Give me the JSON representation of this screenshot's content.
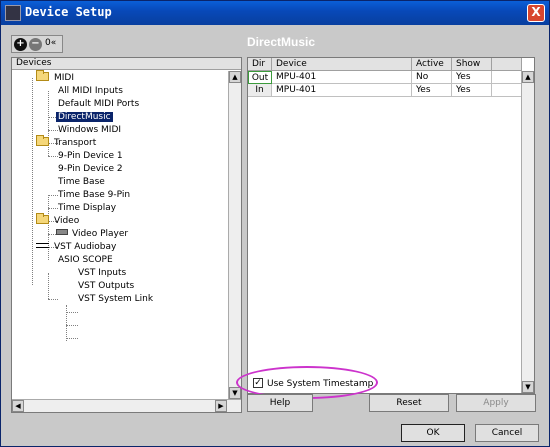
{
  "window": {
    "title": "Device Setup",
    "close_label": "X"
  },
  "toolbar": {
    "add_label": "+",
    "remove_label": "−",
    "collapse_label": "0«"
  },
  "section_title": "DirectMusic",
  "tree": {
    "header": "Devices",
    "nodes": [
      {
        "label": "MIDI",
        "icon": "folder-icon"
      },
      {
        "label": "All MIDI Inputs"
      },
      {
        "label": "Default MIDI Ports"
      },
      {
        "label": "DirectMusic",
        "selected": true
      },
      {
        "label": "Windows MIDI"
      },
      {
        "label": "Transport",
        "icon": "folder-icon"
      },
      {
        "label": "9-Pin Device 1"
      },
      {
        "label": "9-Pin Device 2"
      },
      {
        "label": "Time Base"
      },
      {
        "label": "Time Base 9-Pin"
      },
      {
        "label": "Time Display"
      },
      {
        "label": "Video",
        "icon": "folder-icon"
      },
      {
        "label": "Video Player",
        "icon": "video-icon"
      },
      {
        "label": "VST Audiobay",
        "icon": "audio-icon"
      },
      {
        "label": "ASIO SCOPE"
      },
      {
        "label": "VST Inputs"
      },
      {
        "label": "VST Outputs"
      },
      {
        "label": "VST System Link"
      }
    ]
  },
  "table": {
    "columns": [
      "Dir",
      "Device",
      "Active",
      "Show"
    ],
    "rows": [
      {
        "dir": "Out",
        "device": "MPU-401",
        "active": "No",
        "show": "Yes"
      },
      {
        "dir": "In",
        "device": "MPU-401",
        "active": "Yes",
        "show": "Yes"
      }
    ]
  },
  "timestamp_option": {
    "label": "Use System Timestamp",
    "checked": true
  },
  "buttons": {
    "help": "Help",
    "reset": "Reset",
    "apply": "Apply",
    "ok": "OK",
    "cancel": "Cancel"
  },
  "colors": {
    "title_bar": "#0849b9",
    "selection": "#0a246a",
    "highlight_ring": "#cc33cc"
  }
}
